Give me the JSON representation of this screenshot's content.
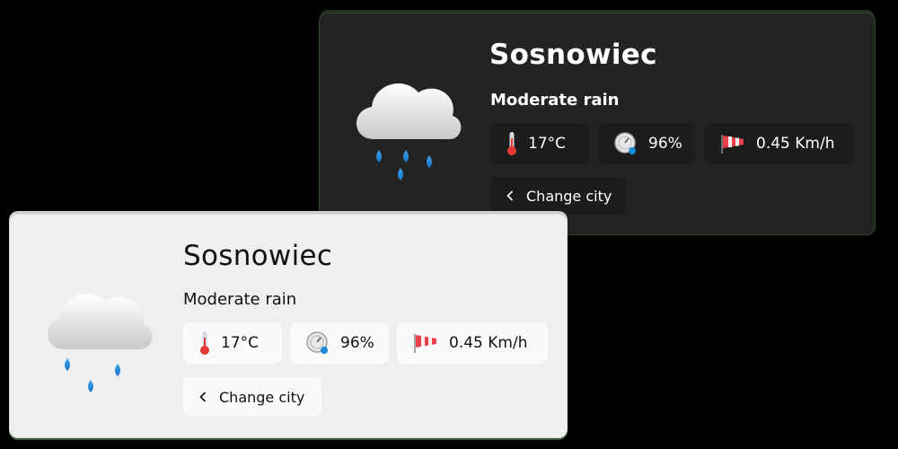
{
  "dark_card": {
    "city": "Sosnowiec",
    "condition": "Moderate rain",
    "temperature": "17°C",
    "humidity": "96%",
    "wind": "0.45 Km/h",
    "change_city_label": "Change city"
  },
  "light_card": {
    "city": "Sosnowiec",
    "condition": "Moderate rain",
    "temperature": "17°C",
    "humidity": "96%",
    "wind": "0.45 Km/h",
    "change_city_label": "Change city"
  },
  "icons": {
    "weather": "rain-cloud-icon",
    "temperature": "thermometer-icon",
    "humidity": "humidity-gauge-icon",
    "wind": "windsock-icon",
    "back": "chevron-left-icon"
  },
  "colors": {
    "dark_card_bg": "#232324",
    "light_card_bg": "#efefef",
    "rain_drop": "#1e88d8",
    "windsock": "#e8414a"
  }
}
